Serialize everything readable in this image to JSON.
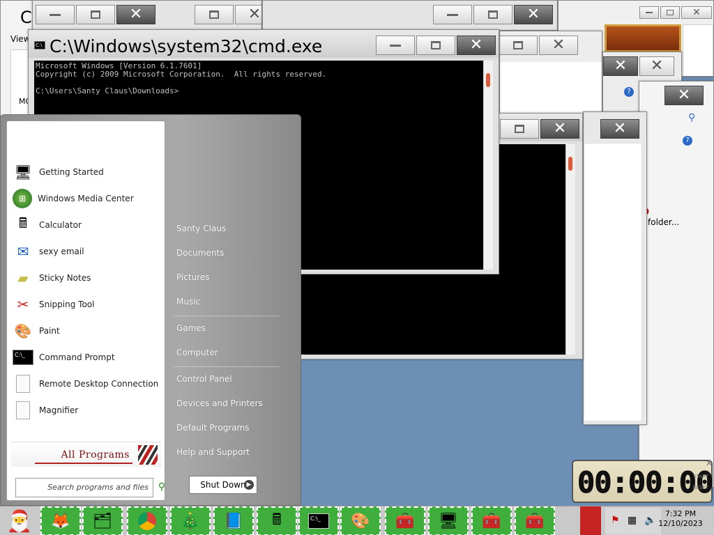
{
  "background_windows": {
    "top_left_partial_title": "C",
    "view_label": "View",
    "mo_label": "MO",
    "folder_label": "folder..."
  },
  "cmd": {
    "title": "C:\\Windows\\system32\\cmd.exe",
    "line1": "Microsoft Windows [Version 6.1.7601]",
    "line2": "Copyright (c) 2009 Microsoft Corporation.  All rights reserved.",
    "line3": "C:\\Users\\Santy Claus\\Downloads>"
  },
  "start_menu": {
    "programs": [
      {
        "label": "Getting Started",
        "icon": "getting-started-icon"
      },
      {
        "label": "Windows Media Center",
        "icon": "media-center-icon"
      },
      {
        "label": "Calculator",
        "icon": "calculator-icon"
      },
      {
        "label": "sexy email",
        "icon": "email-icon"
      },
      {
        "label": "Sticky Notes",
        "icon": "sticky-notes-icon"
      },
      {
        "label": "Snipping Tool",
        "icon": "snipping-tool-icon"
      },
      {
        "label": "Paint",
        "icon": "paint-icon"
      },
      {
        "label": "Command Prompt",
        "icon": "command-prompt-icon"
      },
      {
        "label": "Remote Desktop Connection",
        "icon": "document-icon"
      },
      {
        "label": "Magnifier",
        "icon": "document-icon"
      }
    ],
    "all_programs": "All Programs",
    "search_placeholder": "Search programs and files",
    "right": [
      "Santy Claus",
      "Documents",
      "Pictures",
      "Music",
      "Games",
      "Computer",
      "Control Panel",
      "Devices and Printers",
      "Default Programs",
      "Help and Support"
    ],
    "shutdown": "Shut Down"
  },
  "gadget": {
    "time": "00:00:00",
    "start": "START",
    "reset": "RESET"
  },
  "taskbar": {
    "time": "7:32 PM",
    "date": "12/10/2023"
  },
  "colors": {
    "taskbar_green": "#3fae3c",
    "taskbar_red": "#c62323"
  }
}
